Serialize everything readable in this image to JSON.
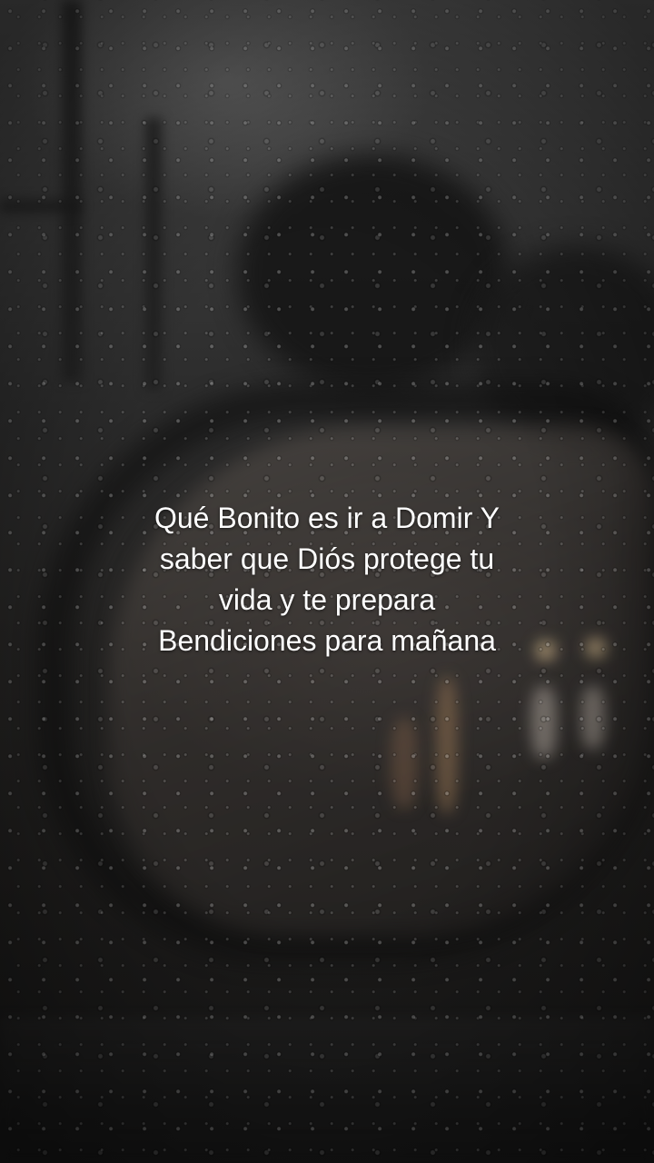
{
  "caption": {
    "lines": [
      "Qué Bonito es ir a Domir Y",
      "saber que Diós protege tu",
      "vida y te prepara",
      "Bendiciones para mañana"
    ],
    "color": "#ffffff"
  },
  "scene": {
    "description_icon": "rainy-window-mirror-background"
  }
}
